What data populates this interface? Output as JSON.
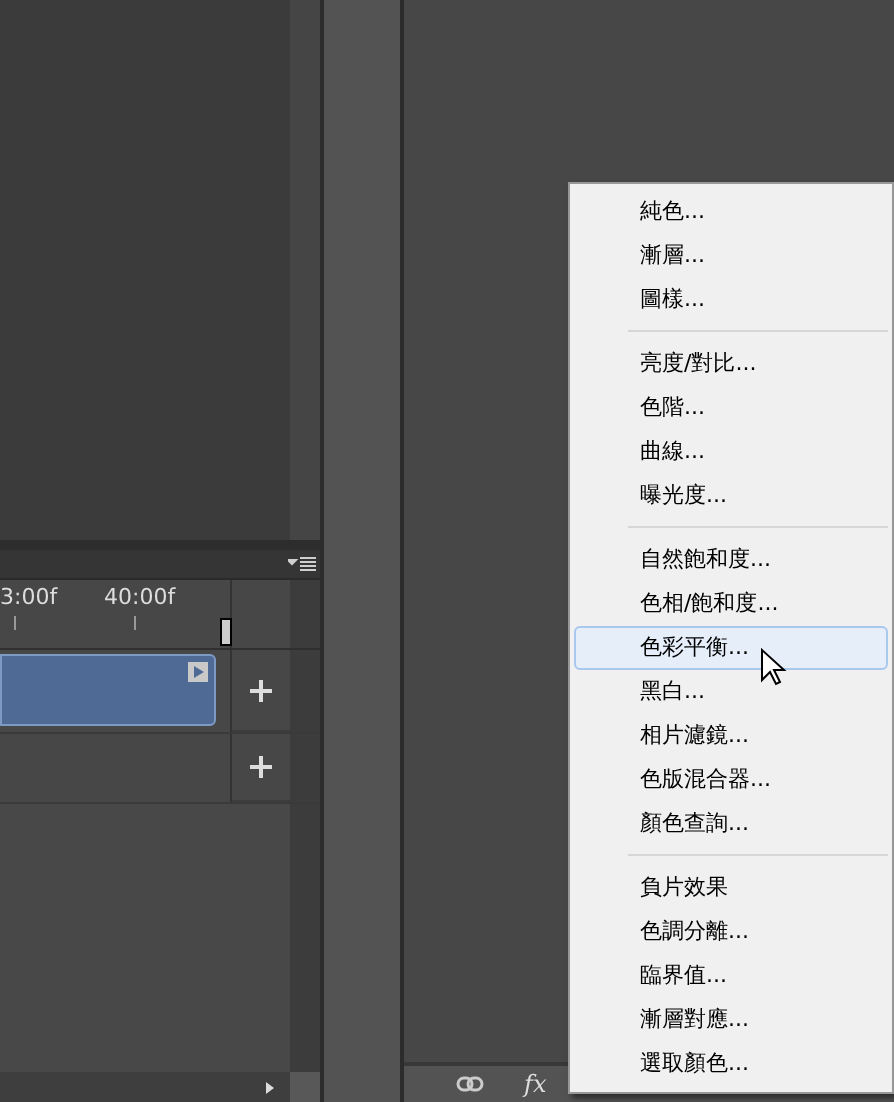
{
  "timeline": {
    "ruler_labels": [
      "3:00f",
      "40:00f"
    ],
    "tracks": [
      {
        "kind": "clip"
      },
      {
        "kind": "empty"
      }
    ]
  },
  "layers_toolbar": {
    "fx_label": "fx"
  },
  "menu": {
    "groups": [
      {
        "items": [
          {
            "label": "純色...",
            "selected": false
          },
          {
            "label": "漸層...",
            "selected": false
          },
          {
            "label": "圖樣...",
            "selected": false
          }
        ]
      },
      {
        "items": [
          {
            "label": "亮度/對比...",
            "selected": false
          },
          {
            "label": "色階...",
            "selected": false
          },
          {
            "label": "曲線...",
            "selected": false
          },
          {
            "label": "曝光度...",
            "selected": false
          }
        ]
      },
      {
        "items": [
          {
            "label": "自然飽和度...",
            "selected": false
          },
          {
            "label": "色相/飽和度...",
            "selected": false
          },
          {
            "label": "色彩平衡...",
            "selected": true
          },
          {
            "label": "黑白...",
            "selected": false
          },
          {
            "label": "相片濾鏡...",
            "selected": false
          },
          {
            "label": "色版混合器...",
            "selected": false
          },
          {
            "label": "顏色查詢...",
            "selected": false
          }
        ]
      },
      {
        "items": [
          {
            "label": "負片效果",
            "selected": false
          },
          {
            "label": "色調分離...",
            "selected": false
          },
          {
            "label": "臨界值...",
            "selected": false
          },
          {
            "label": "漸層對應...",
            "selected": false
          },
          {
            "label": "選取顏色...",
            "selected": false
          }
        ]
      }
    ]
  }
}
